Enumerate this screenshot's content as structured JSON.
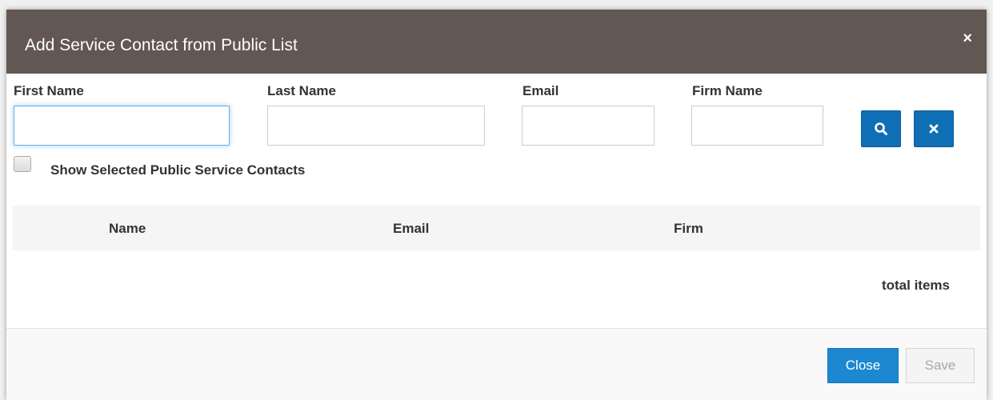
{
  "modal": {
    "title": "Add Service Contact from Public List",
    "close_symbol": "×"
  },
  "filters": {
    "first_name": {
      "label": "First Name",
      "value": "",
      "placeholder": ""
    },
    "last_name": {
      "label": "Last Name",
      "value": "",
      "placeholder": ""
    },
    "email": {
      "label": "Email",
      "value": "",
      "placeholder": ""
    },
    "firm_name": {
      "label": "Firm Name",
      "value": "",
      "placeholder": ""
    },
    "search_icon": "search-icon",
    "clear_icon": "times-icon"
  },
  "show_selected": {
    "label": "Show Selected Public Service Contacts",
    "checked": false
  },
  "table": {
    "columns": [
      "Name",
      "Email",
      "Firm"
    ],
    "rows": [],
    "total_items_label": "total items"
  },
  "footer": {
    "close_label": "Close",
    "save_label": "Save"
  },
  "colors": {
    "header_bg": "#635753",
    "primary": "#1c88d1",
    "icon_button": "#0f6fb5",
    "disabled_text": "#a8a8a8"
  }
}
